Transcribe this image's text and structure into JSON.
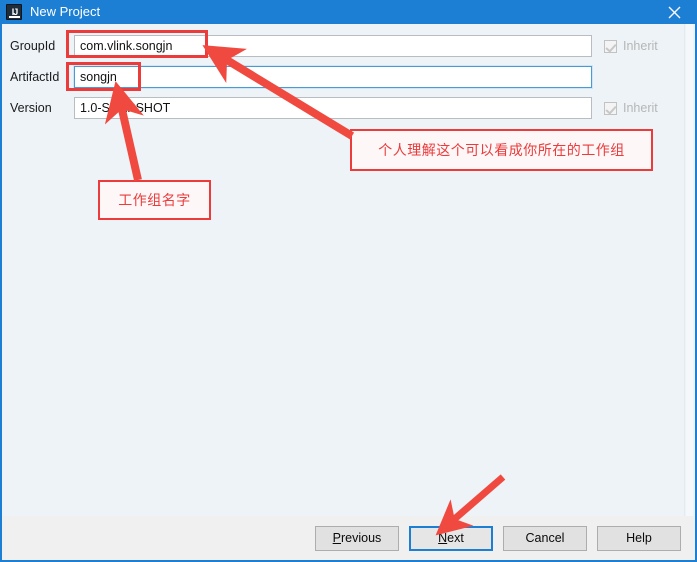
{
  "window": {
    "title": "New Project",
    "icon": "intellij-idea-icon",
    "close_icon": "close-icon",
    "titlebar_color": "#1c7fd4"
  },
  "form": {
    "fields": [
      {
        "id": "groupid",
        "label": "GroupId",
        "value": "com.vlink.songjn",
        "focused": false,
        "inherit": {
          "label": "Inherit",
          "checked": true,
          "enabled": false
        }
      },
      {
        "id": "artifactid",
        "label": "ArtifactId",
        "value": "songjn",
        "focused": true,
        "inherit": null
      },
      {
        "id": "version",
        "label": "Version",
        "value": "1.0-SNAPSHOT",
        "focused": false,
        "inherit": {
          "label": "Inherit",
          "checked": true,
          "enabled": false
        }
      }
    ]
  },
  "buttons": {
    "previous": {
      "label": "Previous",
      "mnemonic": "P",
      "default": false
    },
    "next": {
      "label": "Next",
      "mnemonic": "N",
      "default": true
    },
    "cancel": {
      "label": "Cancel",
      "mnemonic": "",
      "default": false
    },
    "help": {
      "label": "Help",
      "mnemonic": "",
      "default": false
    }
  },
  "annotations": {
    "color": "#ec3b3b",
    "note_groupid": "个人理解这个可以看成你所在的工作组",
    "note_artifactid": "工作组名字",
    "highlight_groupid": "groupid-field-highlight",
    "highlight_artifactid": "artifactid-field-highlight",
    "arrow_to_groupid": "arrow-pointing-to-groupid",
    "arrow_to_artifactid": "arrow-pointing-to-artifactid",
    "arrow_to_next": "arrow-pointing-to-next-button"
  }
}
